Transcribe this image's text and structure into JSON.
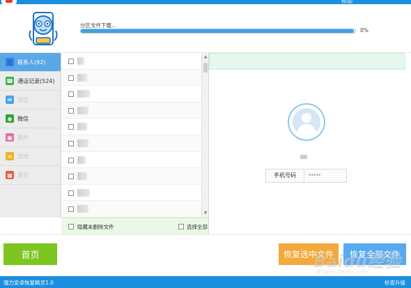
{
  "titlebar": {
    "right_text": "帮助"
  },
  "progress": {
    "label": "分区文件下载...",
    "percent_text": "0%",
    "fraction": 0.995
  },
  "sidebar": {
    "items": [
      {
        "label": "联系人(92)",
        "icon": "contacts-icon",
        "active": true,
        "dim": false,
        "color": "#3c7bd8"
      },
      {
        "label": "通话记录(524)",
        "icon": "phone-icon",
        "active": false,
        "dim": false,
        "color": "#39b54a"
      },
      {
        "label": "短信",
        "icon": "sms-icon",
        "active": false,
        "dim": true,
        "color": "#4aa3e8"
      },
      {
        "label": "微信",
        "icon": "wechat-icon",
        "active": false,
        "dim": false,
        "color": "#2ca234"
      },
      {
        "label": "照片",
        "icon": "photo-icon",
        "active": false,
        "dim": true,
        "color": "#e06fa3"
      },
      {
        "label": "文档",
        "icon": "document-icon",
        "active": false,
        "dim": true,
        "color": "#f0b323"
      },
      {
        "label": "其它",
        "icon": "apps-icon",
        "active": false,
        "dim": true,
        "color": "#e85a4a"
      }
    ]
  },
  "filelist": {
    "rows": 10
  },
  "list_footer": {
    "hide_deleted_label": "隐藏未删除文件",
    "select_all_label": "选择全部"
  },
  "detail": {
    "phone_label": "手机号码",
    "phone_value": "*****"
  },
  "buttons": {
    "home": "首页",
    "recover_selected": "恢复选中文件",
    "recover_all": "恢复全部文件"
  },
  "statusbar": {
    "left": "强力安卓恢复精灵1.0",
    "right": "检查升级"
  },
  "watermark": {
    "text": "Baidu经验",
    "sub": "jingyan.baidu.com"
  },
  "colors": {
    "brand_blue": "#1b8ee0",
    "home_green": "#7cc61f",
    "recover_orange": "#f3a93b",
    "recover_blue": "#58aaf0"
  }
}
